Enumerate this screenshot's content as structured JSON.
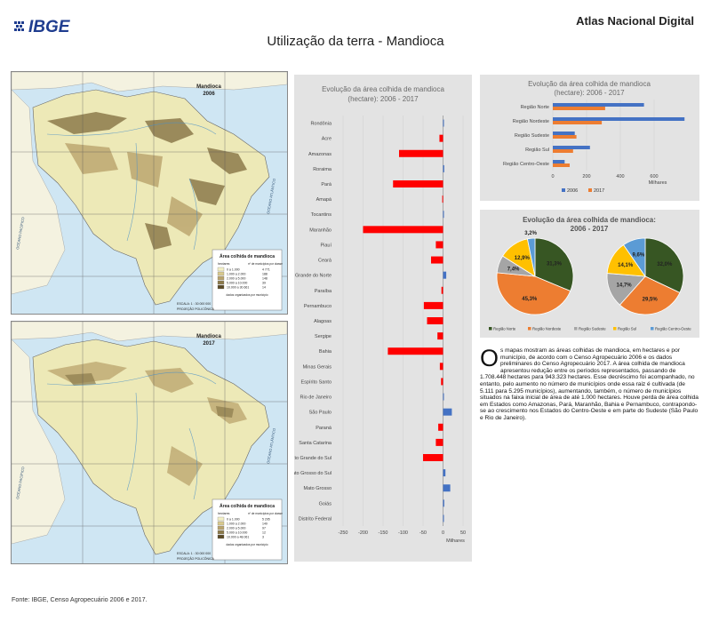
{
  "header": {
    "logo_text": "IBGE",
    "atlas": "Atlas Nacional Digital",
    "title": "Utilização da terra - Mandioca"
  },
  "maps": [
    {
      "title_line1": "Mandioca",
      "title_line2": "2006",
      "legend_title": "Área colhida de mandioca",
      "legend_hdr_left": "hectares",
      "legend_hdr_right": "nº de municípios por classe",
      "legend_rows": [
        {
          "range": "0 a 1.000",
          "count": "4 771"
        },
        {
          "range": "1.000 a 2.000",
          "count": "188"
        },
        {
          "range": "2.000 a 5.000",
          "count": "148"
        },
        {
          "range": "5.000 a 10.000",
          "count": "39"
        },
        {
          "range": "10.000 a 30.661",
          "count": "14"
        }
      ],
      "legend_note": "dados organizados por município",
      "scale": "ESCALA: 1 : 30 000 000",
      "projection": "PROJEÇÃO POLICÔNICA"
    },
    {
      "title_line1": "Mandioca",
      "title_line2": "2017",
      "legend_title": "Área colhida de mandioca",
      "legend_hdr_left": "hectares",
      "legend_hdr_right": "nº de municípios por classe",
      "legend_rows": [
        {
          "range": "0 a 1.000",
          "count": "5 295"
        },
        {
          "range": "1.000 a 2.000",
          "count": "149"
        },
        {
          "range": "2.000 a 5.000",
          "count": "97"
        },
        {
          "range": "5.000 a 10.000",
          "count": "12"
        },
        {
          "range": "10.000 a 48.061",
          "count": "3"
        }
      ],
      "legend_note": "dados organizados por município",
      "scale": "ESCALA: 1 : 30 000 000",
      "projection": "PROJEÇÃO POLICÔNICA"
    }
  ],
  "ocean_labels": {
    "atlantico": "OCEANO ATLÂNTICO",
    "pacifico": "OCEANO PACÍFICO"
  },
  "colors": {
    "red": "#ff0000",
    "blue": "#4472c4",
    "orange": "#ed7d31",
    "gray": "#a5a5a5",
    "yellow": "#ffc000",
    "lightblue": "#5b9bd5",
    "darkgreen": "#375623",
    "map_land": "#ede9b7",
    "map_ocean": "#cfe6f3"
  },
  "chart_data": [
    {
      "type": "bar",
      "orientation": "horizontal",
      "title_line1": "Evolução da área colhida de mandioca",
      "title_line2": "(hectare): 2006 - 2017",
      "unit_label": "Milhares",
      "xlim": [
        -250,
        50
      ],
      "ticks": [
        "-250",
        "-200",
        "-150",
        "-100",
        "-50",
        "0",
        "50"
      ],
      "categories": [
        "Rondônia",
        "Acre",
        "Amazonas",
        "Roraima",
        "Pará",
        "Amapá",
        "Tocantins",
        "Maranhão",
        "Piauí",
        "Ceará",
        "Rio Grande do Norte",
        "Paraíba",
        "Pernambuco",
        "Alagoas",
        "Sergipe",
        "Bahia",
        "Minas Gerais",
        "Espírito Santo",
        "Rio de Janeiro",
        "São Paulo",
        "Paraná",
        "Santa Catarina",
        "Rio Grande do Sul",
        "Mato Grosso do Sul",
        "Mato Grosso",
        "Goiás",
        "Distrito Federal"
      ],
      "values": [
        1.5,
        -9,
        -110,
        3,
        -125,
        -2,
        1.5,
        -200,
        -18,
        -30,
        8,
        -4,
        -48,
        -40,
        -14,
        -138,
        -8,
        -5,
        2,
        22,
        -12,
        -18,
        -50,
        6,
        18,
        3,
        0.5
      ]
    },
    {
      "type": "bar",
      "orientation": "horizontal",
      "title_line1": "Evolução da área colhida de mandioca",
      "title_line2": "(hectare): 2006 - 2017",
      "unit_label": "Milhares",
      "xlim": [
        0,
        800
      ],
      "ticks": [
        "0",
        "200",
        "400",
        "600"
      ],
      "categories": [
        "Região Norte",
        "Região Nordeste",
        "Região Sudeste",
        "Região Sul",
        "Região Centro-Oeste"
      ],
      "series": [
        {
          "name": "2006",
          "values": [
            540,
            780,
            130,
            220,
            70
          ]
        },
        {
          "name": "2017",
          "values": [
            310,
            290,
            140,
            120,
            100
          ]
        }
      ]
    },
    {
      "type": "pie",
      "title_line1": "Evolução da área colhida de mandioca:",
      "title_line2": "2006 - 2017",
      "categories": [
        "Região Norte",
        "Região Nordeste",
        "Região Sudeste",
        "Região Sul",
        "Região Centro-Oeste"
      ],
      "pies": [
        {
          "labels": [
            "31,3%",
            "45,3%",
            "7,4%",
            "12,9%",
            "3,2%"
          ],
          "values": [
            31.3,
            45.3,
            7.4,
            12.9,
            3.2
          ]
        },
        {
          "labels": [
            "32,0%",
            "29,5%",
            "14,7%",
            "14,1%",
            "9,6%"
          ],
          "values": [
            32.0,
            29.5,
            14.7,
            14.1,
            9.6
          ]
        }
      ]
    }
  ],
  "text": {
    "dropcap": "O",
    "body": "s mapas mostram as áreas colhidas de mandioca, em hectares e por município, de acordo com o Censo Agropecuário 2006 e os dados preliminares do Censo Agropecuário 2017. A área colhida de mandioca apresentou redução entre os períodos representados, passando de 1.708.448 hectares para 943.323 hectares. Esse decréscimo foi acompanhado, no entanto, pelo aumento no número de municípios onde essa raiz é cultivada (de 5.111 para 5.295 municípios), aumentando, também, o número de municípios situados na faixa inicial de área de até 1.000 hectares. Houve perda de área colhida em Estados como Amazonas, Pará, Maranhão, Bahia e Pernambuco, contrapondo-se ao crescimento nos Estados do Centro-Oeste e em parte do Sudeste (São Paulo e Rio de Janeiro)."
  },
  "footer": "Fonte: IBGE, Censo Agropecuário 2006 e 2017."
}
